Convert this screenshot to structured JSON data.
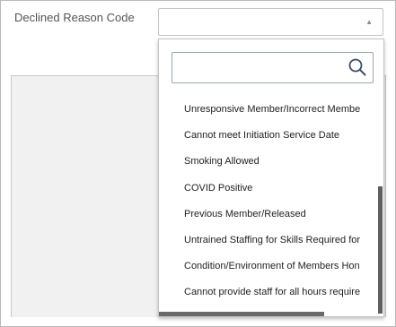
{
  "field": {
    "label": "Declined Reason Code",
    "value": ""
  },
  "caret_icon": "▲",
  "search": {
    "placeholder": "",
    "value": ""
  },
  "options": [
    "Unresponsive Member/Incorrect Membe",
    "Cannot meet Initiation Service Date",
    "Smoking Allowed",
    "COVID Positive",
    "Previous Member/Released",
    "Untrained Staffing for Skills Required for",
    "Condition/Environment of Members Hon",
    "Cannot provide staff for all hours require"
  ]
}
